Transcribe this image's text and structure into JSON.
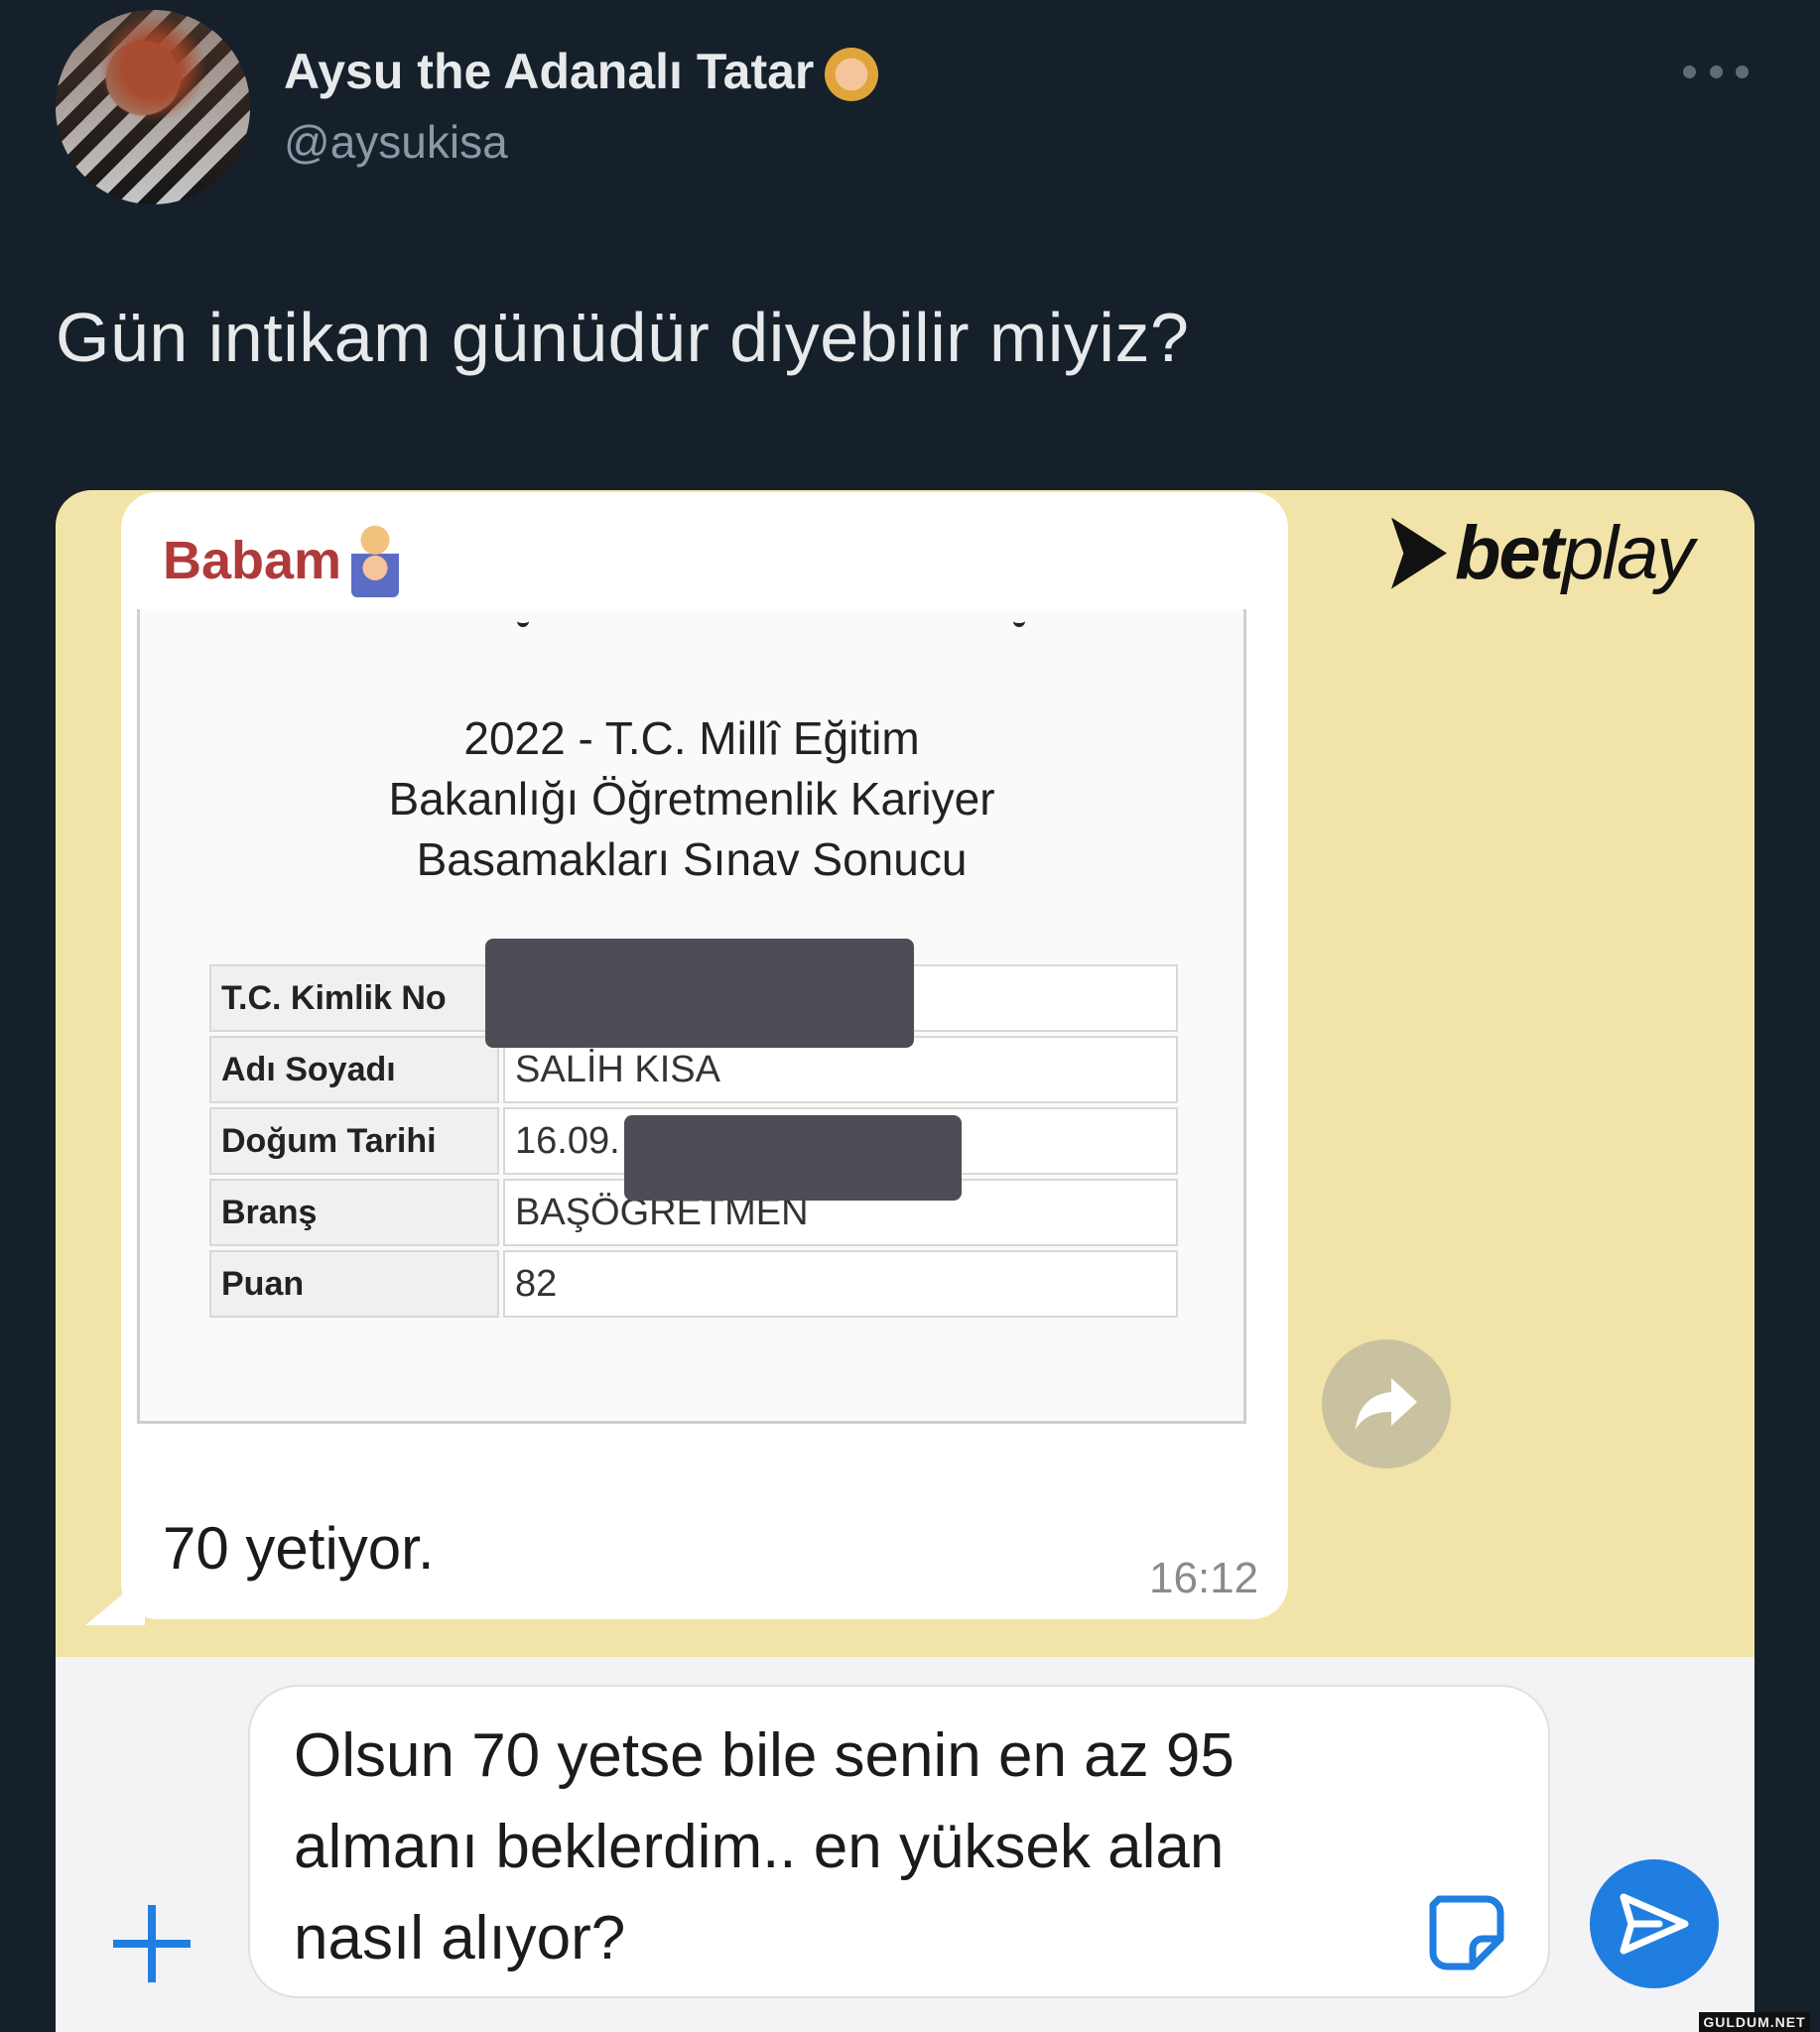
{
  "tweet": {
    "display_name": "Aysu the Adanalı Tatar",
    "handle": "@aysukisa",
    "text": "Gün intikam günüdür diyebilir miyiz?"
  },
  "chat": {
    "sender": "Babam",
    "document": {
      "title_lines": [
        "2022 - T.C. Millî Eğitim",
        "Bakanlığı Öğretmenlik Kariyer",
        "Basamakları Sınav Sonucu"
      ],
      "rows": [
        {
          "label": "T.C. Kimlik No",
          "value": ""
        },
        {
          "label": "Adı Soyadı",
          "value": "SALİH  KISA"
        },
        {
          "label": "Doğum Tarihi",
          "value": "16.09."
        },
        {
          "label": "Branş",
          "value": "BAŞÖĞRETMEN"
        },
        {
          "label": "Puan",
          "value": "82"
        }
      ]
    },
    "message_text": "70 yetiyor.",
    "time": "16:12",
    "composer": {
      "lines": [
        "Olsun 70 yetse bile senin en az 95",
        "almanı beklerdim.. en yüksek alan",
        "nasıl alıyor?"
      ]
    }
  },
  "brand": {
    "bold": "bet",
    "light": "play"
  },
  "watermark": "GULDUM.NET",
  "colors": {
    "background": "#15202b",
    "chat_wallpaper": "#f2e3a8",
    "sender_name": "#b03a3a",
    "send_button": "#1f7ee0"
  },
  "icons": [
    "more-icon",
    "forward-icon",
    "plus-icon",
    "sticker-icon",
    "send-icon"
  ]
}
